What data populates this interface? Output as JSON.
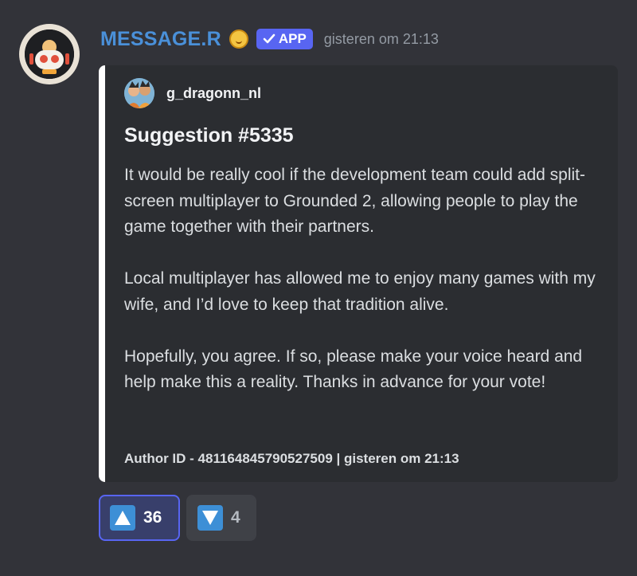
{
  "message": {
    "username": "MESSAGE.R",
    "badge_label": "APP",
    "badge_icon": "check-icon",
    "timestamp": "gisteren om 21:13"
  },
  "embed": {
    "author": "g_dragonn_nl",
    "title": "Suggestion #5335",
    "paragraphs": [
      "It would be really cool if the development team could add split-screen multiplayer to Grounded 2, allowing people to play the game together with their partners.",
      "Local multiplayer has allowed me to enjoy many games with my wife, and I’d love to keep that tradition alive.",
      "Hopefully, you agree. If so, please make your voice heard and help make this a reality. Thanks in advance for your vote!"
    ],
    "footer": "Author ID - 481164845790527509 | gisteren om 21:13",
    "accent_color": "#ffffff"
  },
  "reactions": [
    {
      "emoji": "arrow-up-icon",
      "count": "36",
      "active": true
    },
    {
      "emoji": "arrow-down-icon",
      "count": "4",
      "active": false
    }
  ],
  "colors": {
    "background": "#323339",
    "embed_background": "#2b2d31",
    "username": "#4a90d9",
    "app_badge": "#5865f2",
    "reaction_emoji": "#3d8fd6"
  }
}
